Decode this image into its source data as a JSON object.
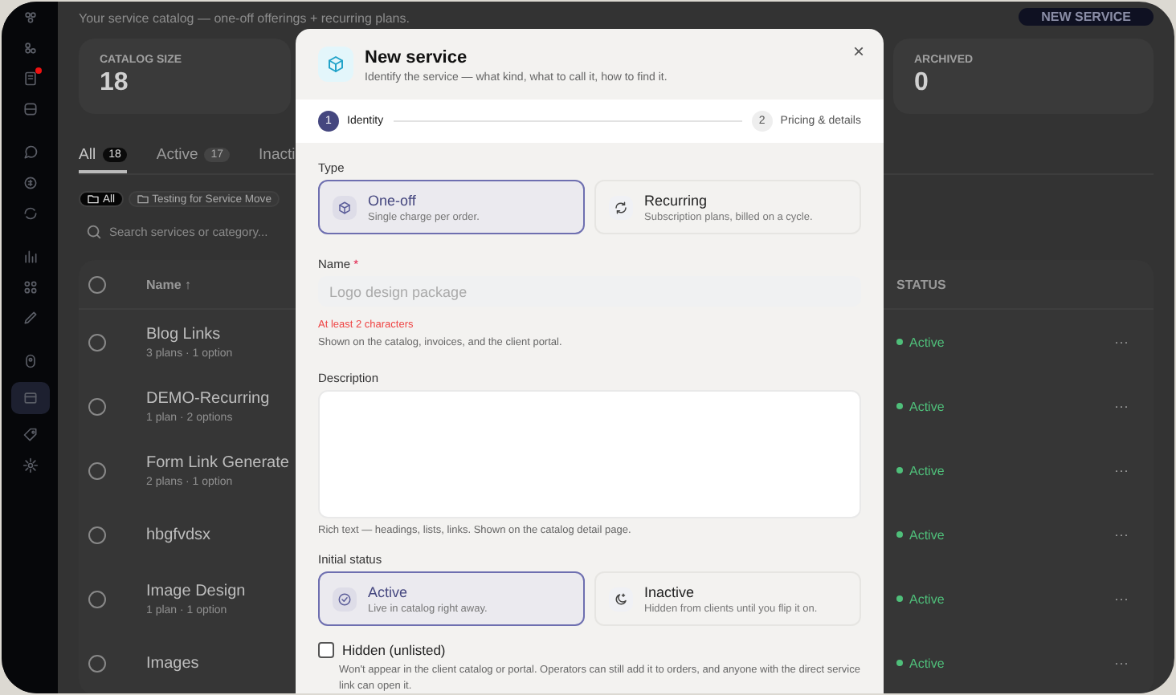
{
  "sidebar": {
    "items": [
      {
        "selected": false,
        "alert": false
      },
      {
        "selected": false,
        "alert": false
      },
      {
        "selected": false,
        "alert": true
      },
      {
        "selected": false,
        "alert": false
      },
      {
        "selected": false,
        "alert": false
      },
      {
        "selected": false,
        "alert": false
      },
      {
        "selected": false,
        "alert": false
      },
      {
        "selected": false,
        "alert": false
      },
      {
        "selected": false,
        "alert": false
      },
      {
        "selected": false,
        "alert": false
      },
      {
        "selected": false,
        "alert": false
      },
      {
        "selected": true,
        "alert": false
      },
      {
        "selected": false,
        "alert": false
      },
      {
        "selected": false,
        "alert": false
      }
    ]
  },
  "page": {
    "subtitle": "Your service catalog — one-off offerings + recurring plans.",
    "new_button": "NEW SERVICE",
    "stats": [
      {
        "label": "CATALOG SIZE",
        "value": "18"
      },
      {
        "label": "ARCHIVED",
        "value": "0"
      }
    ],
    "tabs": [
      {
        "label": "All",
        "count": "18",
        "selected": true
      },
      {
        "label": "Active",
        "count": "17",
        "selected": false
      },
      {
        "label": "Inacti",
        "selected": false
      }
    ],
    "chips": [
      {
        "label": "All",
        "selected": true
      },
      {
        "label": "Testing for Service Move",
        "selected": false
      }
    ],
    "search": {
      "placeholder": "Search services or category..."
    },
    "table": {
      "columns": [
        "Name ↑",
        "STATUS"
      ],
      "all_selected": false,
      "rows": [
        {
          "name": "Blog Links",
          "meta": "3 plans · 1 option",
          "status": "Active",
          "menu": "···",
          "selected": false
        },
        {
          "name": "DEMO-Recurring",
          "meta": "1 plan · 2 options",
          "status": "Active",
          "menu": "···",
          "selected": false
        },
        {
          "name": "Form Link Generate",
          "meta": "2 plans · 1 option",
          "status": "Active",
          "menu": "···",
          "selected": false
        },
        {
          "name": "hbgfvdsx",
          "status": "Active",
          "menu": "···",
          "selected": false
        },
        {
          "name": "Image Design",
          "meta": "1 plan · 1 option",
          "status": "Active",
          "menu": "···",
          "selected": false
        },
        {
          "name": "Images",
          "status": "Active",
          "menu": "···",
          "selected": false
        }
      ]
    }
  },
  "modal": {
    "title": "New service",
    "subtitle": "Identify the service — what kind, what to call it, how to find it.",
    "close": "×",
    "steps": [
      {
        "number": "1",
        "label": "Identity",
        "selected": true
      },
      {
        "number": "2",
        "label": "Pricing & details",
        "selected": false
      }
    ],
    "type": {
      "label": "Type",
      "options": [
        {
          "title": "One-off",
          "description": "Single charge per order.",
          "selected": true
        },
        {
          "title": "Recurring",
          "description": "Subscription plans, billed on a cycle.",
          "selected": false
        }
      ]
    },
    "name": {
      "label": "Name",
      "required_mark": "*",
      "placeholder": "Logo design package",
      "error": "At least 2 characters",
      "help": "Shown on the catalog, invoices, and the client portal."
    },
    "description": {
      "label": "Description",
      "help": "Rich text — headings, lists, links. Shown on the catalog detail page."
    },
    "status": {
      "label": "Initial status",
      "options": [
        {
          "title": "Active",
          "description": "Live in catalog right away.",
          "selected": true
        },
        {
          "title": "Inactive",
          "description": "Hidden from clients until you flip it on.",
          "selected": false
        }
      ]
    },
    "hidden": {
      "label": "Hidden (unlisted)",
      "checked": false,
      "help": "Won't appear in the client catalog or portal. Operators can still add it to orders, and anyone with the direct service link can open it."
    }
  }
}
